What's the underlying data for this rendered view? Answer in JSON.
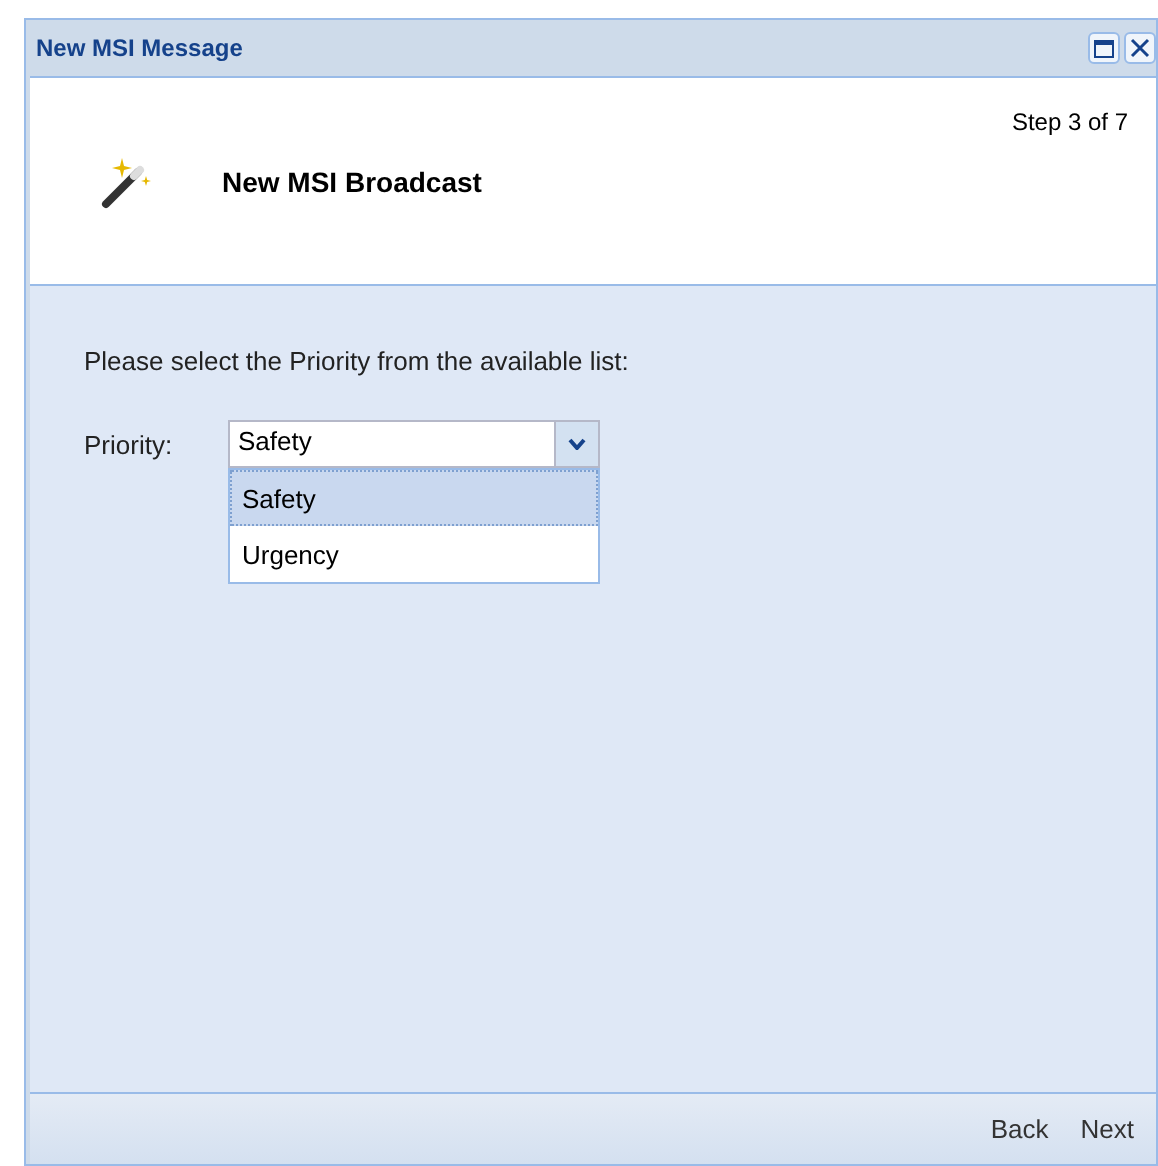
{
  "window": {
    "title": "New MSI Message"
  },
  "header": {
    "title": "New MSI Broadcast",
    "step": "Step 3 of 7"
  },
  "body": {
    "instruction": "Please select the Priority from the available list:",
    "field": {
      "label": "Priority:",
      "value": "Safety",
      "expanded": true,
      "options": [
        {
          "label": "Safety",
          "selected": true
        },
        {
          "label": "Urgency",
          "selected": false
        }
      ]
    }
  },
  "buttons": [
    "Back",
    "Next"
  ]
}
